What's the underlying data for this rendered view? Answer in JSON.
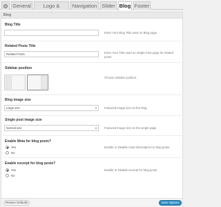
{
  "tabs": [
    {
      "label": "General"
    },
    {
      "label": "Logo & Favicon"
    },
    {
      "label": "Navigation"
    },
    {
      "label": "Slider"
    },
    {
      "label": "Blog"
    },
    {
      "label": "Footer"
    }
  ],
  "panel": {
    "title": "Blog"
  },
  "blog_title": {
    "label": "Blog Title",
    "value": "",
    "desc": "Enter Your Blog Title used on Blog page."
  },
  "related_posts": {
    "label": "Related Posts Title",
    "value": "Related Posts",
    "desc": "Enter Your Title used on Single Post page for related posts."
  },
  "sidebar_position": {
    "label": "Sidebar position",
    "desc": "Choose sidebar position."
  },
  "blog_image_size": {
    "label": "Blog image size",
    "selected": "Large size",
    "desc": "Featured image size on the blog."
  },
  "single_image_size": {
    "label": "Single post image size",
    "selected": "Normal size",
    "desc": "Featured image size on the single page."
  },
  "meta": {
    "label": "Enable Meta for blog posts?",
    "options": [
      "Yes",
      "No"
    ],
    "selected": "Yes",
    "desc": "Enable or Disable meta information for blog posts."
  },
  "excerpt": {
    "label": "Enable excerpt for blog posts?",
    "options": [
      "Yes",
      "No"
    ],
    "selected": "Yes",
    "desc": "Enable or Disable excerpt for blog posts."
  },
  "footer": {
    "reset_label": "Restore Defaults",
    "save_label": "Save Options"
  }
}
